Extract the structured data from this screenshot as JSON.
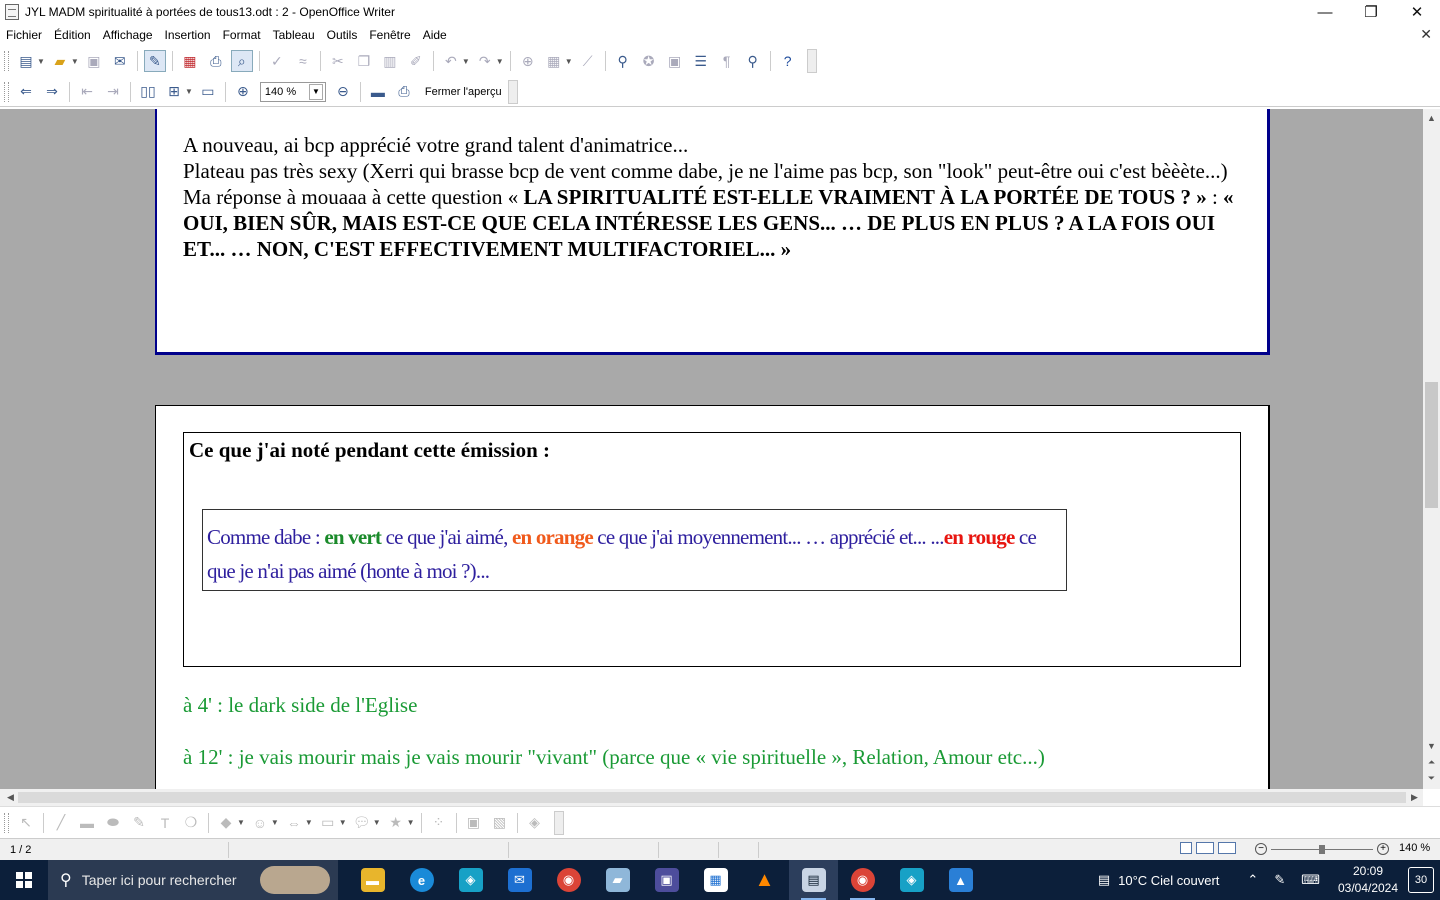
{
  "window": {
    "title": "JYL  MADM spiritualité à portées de tous13.odt : 2 - OpenOffice Writer",
    "min_glyph": "—",
    "max_glyph": "❐",
    "close_glyph": "✕",
    "doc_close_glyph": "✕"
  },
  "menu": [
    "Fichier",
    "Édition",
    "Affichage",
    "Insertion",
    "Format",
    "Tableau",
    "Outils",
    "Fenêtre",
    "Aide"
  ],
  "toolbar": {
    "zoom_value": "140 %",
    "close_preview_label": "Fermer l'aperçu"
  },
  "document": {
    "page1": {
      "line1": "A nouveau, ai bcp apprécié votre grand talent d'animatrice...",
      "line2": "Plateau pas très sexy (Xerri  qui brasse bcp de vent comme dabe, je ne l'aime pas bcp, son \"look\" peut-être oui c'est bèèète...)",
      "line3_prefix": "Ma réponse à mouaaa à cette question « ",
      "line3_bold": "LA SPIRITUALITÉ EST-ELLE VRAIMENT À LA PORTÉE DE TOUS ? » ",
      "line3_mid": " : ",
      "line3_bold2": "« OUI, BIEN SÛR, MAIS EST-CE QUE CELA INTÉRESSE LES GENS... … DE PLUS EN PLUS ? A LA FOIS OUI ET... … NON, C'EST EFFECTIVEMENT MULTIFACTORIEL... »"
    },
    "page2": {
      "heading": "Ce que j'ai noté pendant cette émission :",
      "legend": {
        "t1": "Comme dabe : ",
        "green": "en vert",
        "t2": " ce que j'ai aimé, ",
        "orange": "en orange",
        "t3": " ce que j'ai moyennement... … apprécié et... ...",
        "red": "en rouge",
        "t4": " ce que je n'ai pas aimé (honte à moi ?)..."
      },
      "notes": [
        "à 4' : le dark side de l'Eglise",
        "à 12' : je vais mourir mais je vais mourir \"vivant\" (parce que « vie spirituelle », Relation, Amour etc...)"
      ]
    }
  },
  "statusbar": {
    "page_count": "1 / 2",
    "zoom_value": "140 %",
    "zoom_level_fraction": 0.5
  },
  "taskbar": {
    "search_placeholder": "Taper ici pour rechercher",
    "weather": "10°C  Ciel couvert",
    "time": "20:09",
    "date": "03/04/2024",
    "notifications": "30"
  },
  "colors": {
    "page_border": "#00008b",
    "legend_text": "#2e1f9e",
    "green": "#1a8a2a",
    "orange": "#f05a1c",
    "red": "#e8150f",
    "note_green": "#1a9a35",
    "taskbar": "#0c1f3a"
  }
}
